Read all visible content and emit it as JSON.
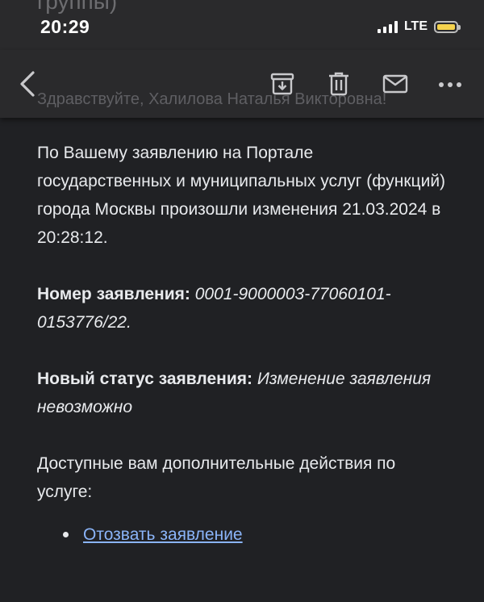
{
  "status_bar": {
    "time": "20:29",
    "network": "LTE",
    "battery_color": "#f4d24d"
  },
  "background_text": {
    "top_fragment": "группы)",
    "greeting": "Здравствуйте, Халилова Наталья Викторовна!"
  },
  "toolbar": {
    "back_icon": "chevron-left-icon",
    "archive_icon": "archive-icon",
    "delete_icon": "trash-icon",
    "mark_unread_icon": "mail-icon",
    "more_icon": "more-horizontal-icon"
  },
  "email": {
    "intro": "По Вашему заявлению на Портале государственных и муниципальных услуг (функций) города Москвы произошли изменения 21.03.2024 в 20:28:12.",
    "application_number_label": "Номер заявления:",
    "application_number_value": "0001-9000003-77060101-0153776/22.",
    "new_status_label": "Новый статус заявления:",
    "new_status_value": "Изменение заявления невозможно",
    "actions_heading": "Доступные вам дополнительные действия по услуге:",
    "actions": [
      {
        "label": "Отозвать заявление"
      }
    ],
    "link_color": "#8ab4f8"
  }
}
